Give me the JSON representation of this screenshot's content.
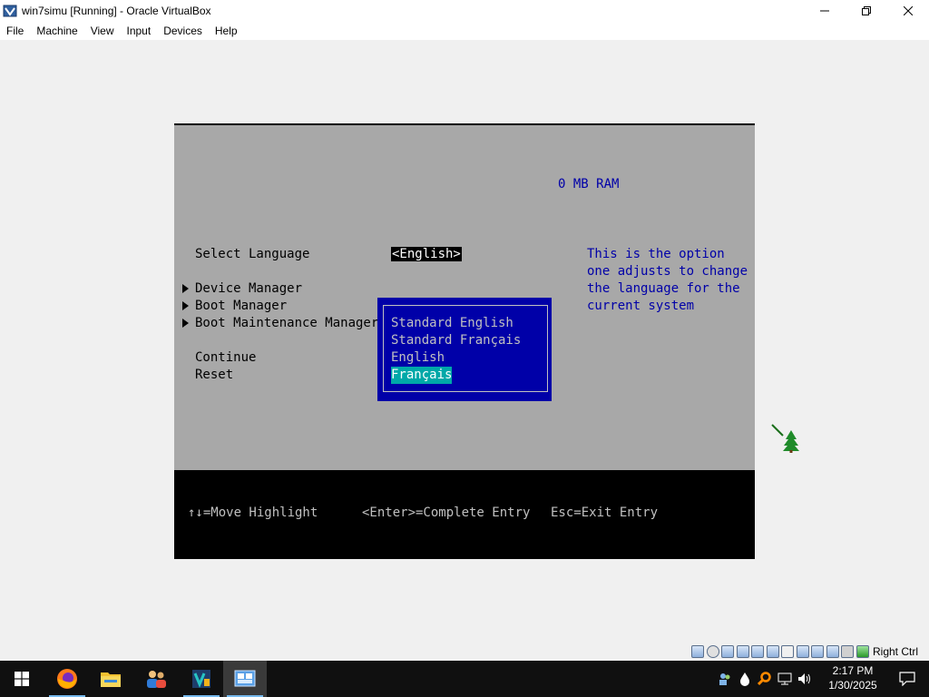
{
  "window": {
    "title": "win7simu [Running] - Oracle VirtualBox",
    "minimize_icon": "minimize-icon",
    "maximize_icon": "restore-icon",
    "close_icon": "close-icon"
  },
  "menu": {
    "items": [
      "File",
      "Machine",
      "View",
      "Input",
      "Devices",
      "Help"
    ]
  },
  "bios": {
    "ram": "0 MB RAM",
    "select_language_label": "Select Language",
    "select_language_value": "<English>",
    "menu_items": [
      "Device Manager",
      "Boot Manager",
      "Boot Maintenance Manager"
    ],
    "actions": [
      "Continue",
      "Reset"
    ],
    "help_text": [
      "This is the option",
      "one adjusts to change",
      "the language for the",
      "current system"
    ],
    "popup_options": [
      "Standard English",
      "Standard Français",
      "English",
      "Français"
    ],
    "popup_selected_index": 3,
    "footer": {
      "move": "↑↓=Move Highlight",
      "enter": "<Enter>=Complete Entry",
      "esc": "Esc=Exit Entry"
    },
    "colors": {
      "background": "#a8a8a8",
      "popup": "#0000a8",
      "highlight": "#00a8a8",
      "help_text": "#0000a8"
    }
  },
  "status_bar": {
    "host_key": "Right Ctrl"
  },
  "taskbar": {
    "apps": [
      "windows-start-icon",
      "firefox-icon",
      "file-explorer-icon",
      "people-app-icon",
      "virtualbox-manager-icon",
      "virtualbox-vm-icon"
    ],
    "clock_time": "2:17 PM",
    "clock_date": "1/30/2025"
  }
}
